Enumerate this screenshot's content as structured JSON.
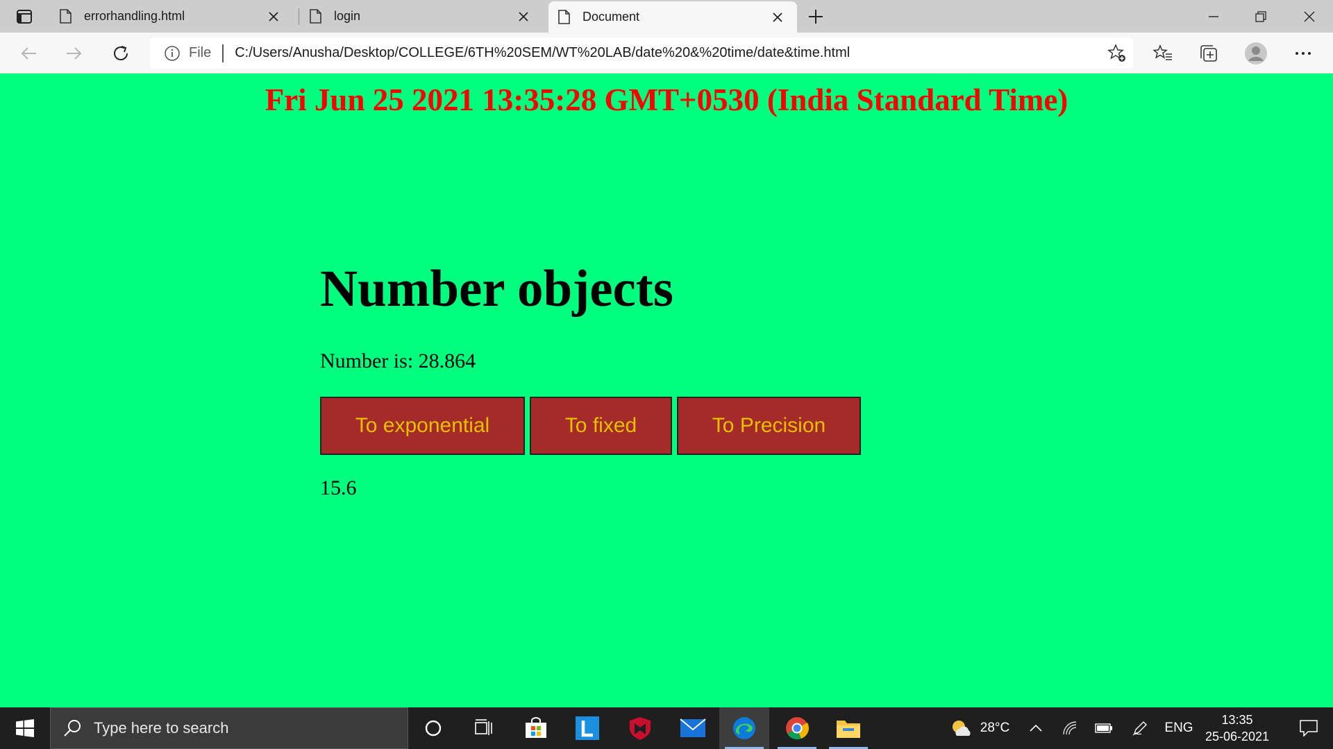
{
  "browser": {
    "tabs": [
      {
        "title": "errorhandling.html"
      },
      {
        "title": "login"
      },
      {
        "title": "Document"
      }
    ],
    "address": {
      "scheme_label": "File",
      "url": "C:/Users/Anusha/Desktop/COLLEGE/6TH%20SEM/WT%20LAB/date%20&%20time/date&time.html"
    }
  },
  "page": {
    "date_text": "Fri Jun 25 2021 13:35:28 GMT+0530 (India Standard Time)",
    "heading": "Number objects",
    "number_text": "Number is: 28.864",
    "buttons": {
      "exponential": "To exponential",
      "fixed": "To fixed",
      "precision": "To Precision"
    },
    "result": "15.6",
    "colors": {
      "background": "#00ff7f",
      "date_text": "#ff0000",
      "button_bg": "#a52a2a",
      "button_text": "#e8c000"
    }
  },
  "taskbar": {
    "search_placeholder": "Type here to search",
    "weather": "28°C",
    "language": "ENG",
    "time": "13:35",
    "date": "25-06-2021",
    "apps": [
      "cortana-icon",
      "task-view-icon",
      "store-icon",
      "l-app-icon",
      "mcafee-icon",
      "mail-icon",
      "edge-icon",
      "chrome-icon",
      "file-explorer-icon"
    ]
  }
}
